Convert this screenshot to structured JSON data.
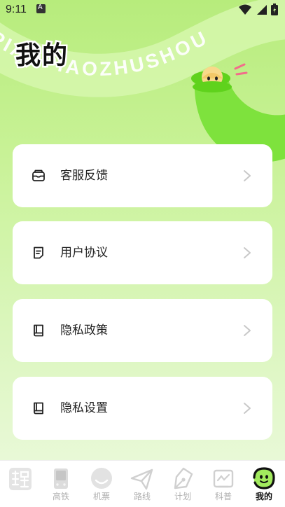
{
  "status_bar": {
    "time": "9:11"
  },
  "header": {
    "title": "我的",
    "banner_text": "PIAOPIAOZHUSHOU"
  },
  "menu": [
    {
      "label": "客服反馈",
      "icon": "inbox-icon"
    },
    {
      "label": "用户协议",
      "icon": "document-icon"
    },
    {
      "label": "隐私政策",
      "icon": "book-icon"
    },
    {
      "label": "隐私设置",
      "icon": "book-icon"
    }
  ],
  "tabs": [
    {
      "label": "",
      "icon": "app-logo-icon",
      "active": false
    },
    {
      "label": "高铁",
      "icon": "train-icon",
      "active": false
    },
    {
      "label": "机票",
      "icon": "smile-icon",
      "active": false
    },
    {
      "label": "路线",
      "icon": "paper-plane-icon",
      "active": false
    },
    {
      "label": "计划",
      "icon": "pen-nib-icon",
      "active": false
    },
    {
      "label": "科普",
      "icon": "science-board-icon",
      "active": false
    },
    {
      "label": "我的",
      "icon": "profile-face-icon",
      "active": true
    }
  ],
  "colors": {
    "accent": "#9fe566",
    "tube": "#7ee23d",
    "background_top": "#b7ec7c",
    "background_bottom": "#edfae0"
  }
}
